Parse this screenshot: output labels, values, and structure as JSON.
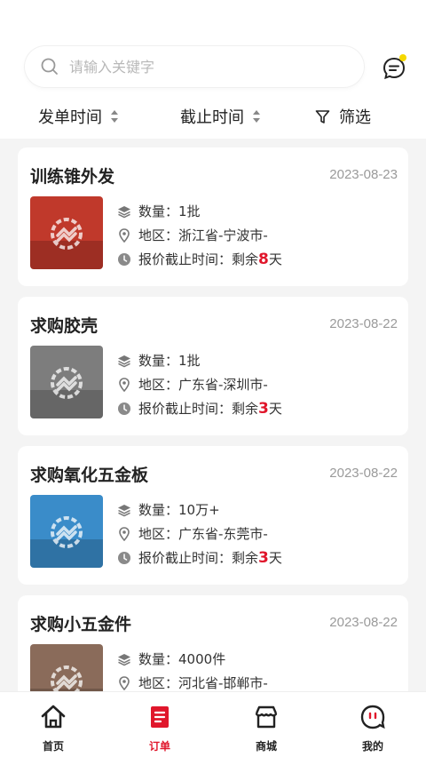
{
  "search": {
    "placeholder": "请输入关键字"
  },
  "filters": {
    "issue_time": "发单时间",
    "deadline": "截止时间",
    "filter": "筛选"
  },
  "info_labels": {
    "quantity": "数量：",
    "region": "地区：",
    "deadline": "报价截止时间：",
    "remaining_prefix": "剩余",
    "day_suffix": "天"
  },
  "orders": [
    {
      "title": "训练锥外发",
      "date": "2023-08-23",
      "quantity": "1批",
      "region": "浙江省-宁波市-",
      "days_left": "8",
      "thumb_color": "#c0392b"
    },
    {
      "title": "求购胶壳",
      "date": "2023-08-22",
      "quantity": "1批",
      "region": "广东省-深圳市-",
      "days_left": "3",
      "thumb_color": "#7d7d7d"
    },
    {
      "title": "求购氧化五金板",
      "date": "2023-08-22",
      "quantity": "10万+",
      "region": "广东省-东莞市-",
      "days_left": "3",
      "thumb_color": "#3a8cc9"
    },
    {
      "title": "求购小五金件",
      "date": "2023-08-22",
      "quantity": "4000件",
      "region": "河北省-邯郸市-",
      "days_left": "",
      "thumb_color": "#8a6b5a"
    }
  ],
  "tabbar": [
    {
      "label": "首页",
      "icon": "home-icon",
      "active": false
    },
    {
      "label": "订单",
      "icon": "order-icon",
      "active": true
    },
    {
      "label": "商城",
      "icon": "store-icon",
      "active": false
    },
    {
      "label": "我的",
      "icon": "profile-icon",
      "active": false
    }
  ],
  "colors": {
    "accent": "#e0162b",
    "badge": "#f5d800"
  }
}
